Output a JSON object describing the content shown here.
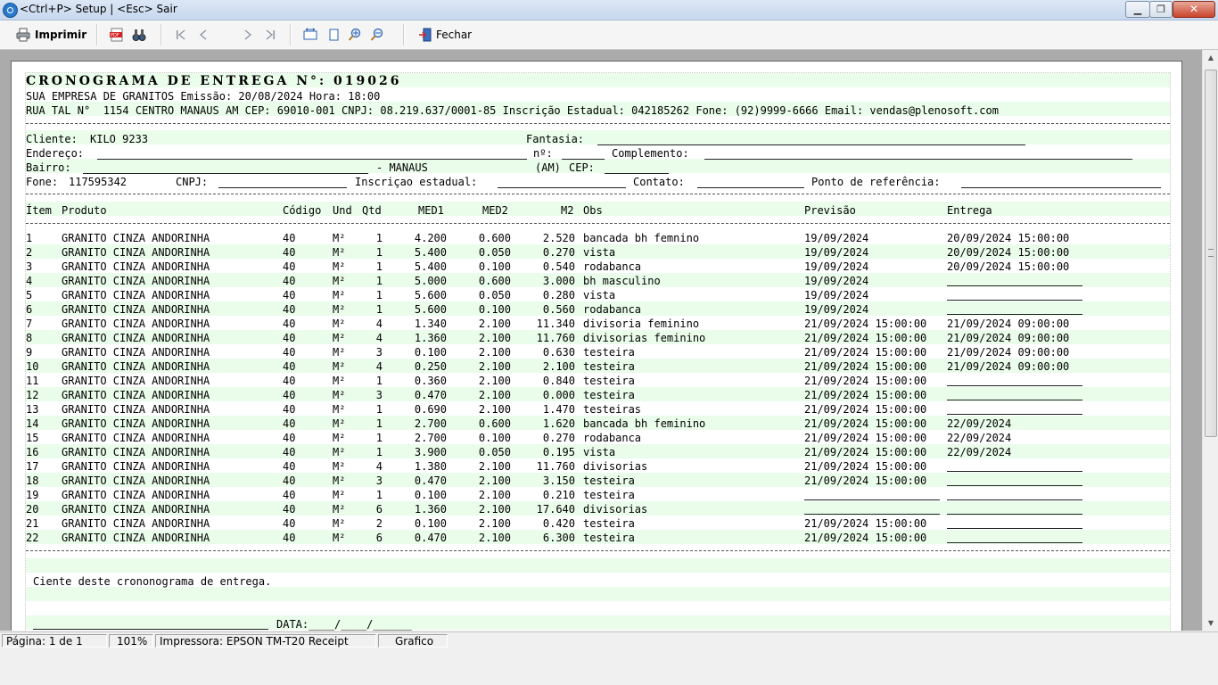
{
  "window": {
    "title": "<Ctrl+P> Setup | <Esc> Sair"
  },
  "toolbar": {
    "print_label": "Imprimir",
    "close_label": "Fechar"
  },
  "report": {
    "title": "CRONOGRAMA DE ENTREGA N°: 019026",
    "company_line": "SUA EMPRESA DE GRANITOS Emissão: 20/08/2024 Hora: 18:00",
    "address_line": "RUA TAL N°  1154 CENTRO MANAUS AM CEP: 69010-001 CNPJ: 08.219.637/0001-85 Inscrição Estadual: 042185262 Fone: (92)9999-6666 Email: vendas@plenosoft.com",
    "client": {
      "cliente_label": "Cliente:",
      "cliente_value": "KILO 9233",
      "fantasia_label": "Fantasia:",
      "endereco_label": "Endereço:",
      "numero_label": "nº:",
      "complemento_label": "Complemento:",
      "bairro_label": "Bairro:",
      "cidade": "- MANAUS",
      "uf": "(AM)",
      "cep_label": "CEP:",
      "fone_label": "Fone:",
      "fone_value": "117595342",
      "cnpj_label": "CNPJ:",
      "ie_label": "Inscriçao estadual:",
      "contato_label": "Contato:",
      "ref_label": "Ponto de referência:"
    },
    "columns": {
      "item": "Ítem",
      "produto": "Produto",
      "codigo": "Código",
      "und": "Und",
      "qtd": "Qtd",
      "med1": "MED1",
      "med2": "MED2",
      "m2": "M2",
      "obs": "Obs",
      "previsao": "Previsão",
      "entrega": "Entrega"
    },
    "items": [
      {
        "item": "1",
        "produto": "GRANITO CINZA ANDORINHA",
        "codigo": "40",
        "und": "M²",
        "qtd": "1",
        "med1": "4.200",
        "med2": "0.600",
        "m2": "2.520",
        "obs": "bancada bh femnino",
        "previsao": "19/09/2024",
        "entrega": "20/09/2024 15:00:00"
      },
      {
        "item": "2",
        "produto": "GRANITO CINZA ANDORINHA",
        "codigo": "40",
        "und": "M²",
        "qtd": "1",
        "med1": "5.400",
        "med2": "0.050",
        "m2": "0.270",
        "obs": "vista",
        "previsao": "19/09/2024",
        "entrega": "20/09/2024 15:00:00"
      },
      {
        "item": "3",
        "produto": "GRANITO CINZA ANDORINHA",
        "codigo": "40",
        "und": "M²",
        "qtd": "1",
        "med1": "5.400",
        "med2": "0.100",
        "m2": "0.540",
        "obs": "rodabanca",
        "previsao": "19/09/2024",
        "entrega": "20/09/2024 15:00:00"
      },
      {
        "item": "4",
        "produto": "GRANITO CINZA ANDORINHA",
        "codigo": "40",
        "und": "M²",
        "qtd": "1",
        "med1": "5.000",
        "med2": "0.600",
        "m2": "3.000",
        "obs": "bh masculino",
        "previsao": "19/09/2024",
        "entrega": ""
      },
      {
        "item": "5",
        "produto": "GRANITO CINZA ANDORINHA",
        "codigo": "40",
        "und": "M²",
        "qtd": "1",
        "med1": "5.600",
        "med2": "0.050",
        "m2": "0.280",
        "obs": "vista",
        "previsao": "19/09/2024",
        "entrega": ""
      },
      {
        "item": "6",
        "produto": "GRANITO CINZA ANDORINHA",
        "codigo": "40",
        "und": "M²",
        "qtd": "1",
        "med1": "5.600",
        "med2": "0.100",
        "m2": "0.560",
        "obs": "rodabanca",
        "previsao": "19/09/2024",
        "entrega": ""
      },
      {
        "item": "7",
        "produto": "GRANITO CINZA ANDORINHA",
        "codigo": "40",
        "und": "M²",
        "qtd": "4",
        "med1": "1.340",
        "med2": "2.100",
        "m2": "11.340",
        "obs": "divisoria feminino",
        "previsao": "21/09/2024 15:00:00",
        "entrega": "21/09/2024 09:00:00"
      },
      {
        "item": "8",
        "produto": "GRANITO CINZA ANDORINHA",
        "codigo": "40",
        "und": "M²",
        "qtd": "4",
        "med1": "1.360",
        "med2": "2.100",
        "m2": "11.760",
        "obs": "divisorias feminino",
        "previsao": "21/09/2024 15:00:00",
        "entrega": "21/09/2024 09:00:00"
      },
      {
        "item": "9",
        "produto": "GRANITO CINZA ANDORINHA",
        "codigo": "40",
        "und": "M²",
        "qtd": "3",
        "med1": "0.100",
        "med2": "2.100",
        "m2": "0.630",
        "obs": "testeira",
        "previsao": "21/09/2024 15:00:00",
        "entrega": "21/09/2024 09:00:00"
      },
      {
        "item": "10",
        "produto": "GRANITO CINZA ANDORINHA",
        "codigo": "40",
        "und": "M²",
        "qtd": "4",
        "med1": "0.250",
        "med2": "2.100",
        "m2": "2.100",
        "obs": "testeira",
        "previsao": "21/09/2024 15:00:00",
        "entrega": "21/09/2024 09:00:00"
      },
      {
        "item": "11",
        "produto": "GRANITO CINZA ANDORINHA",
        "codigo": "40",
        "und": "M²",
        "qtd": "1",
        "med1": "0.360",
        "med2": "2.100",
        "m2": "0.840",
        "obs": "testeira",
        "previsao": "21/09/2024 15:00:00",
        "entrega": ""
      },
      {
        "item": "12",
        "produto": "GRANITO CINZA ANDORINHA",
        "codigo": "40",
        "und": "M²",
        "qtd": "3",
        "med1": "0.470",
        "med2": "2.100",
        "m2": "0.000",
        "obs": "testeira",
        "previsao": "21/09/2024 15:00:00",
        "entrega": ""
      },
      {
        "item": "13",
        "produto": "GRANITO CINZA ANDORINHA",
        "codigo": "40",
        "und": "M²",
        "qtd": "1",
        "med1": "0.690",
        "med2": "2.100",
        "m2": "1.470",
        "obs": "testeiras",
        "previsao": "21/09/2024 15:00:00",
        "entrega": ""
      },
      {
        "item": "14",
        "produto": "GRANITO CINZA ANDORINHA",
        "codigo": "40",
        "und": "M²",
        "qtd": "1",
        "med1": "2.700",
        "med2": "0.600",
        "m2": "1.620",
        "obs": "bancada bh feminino",
        "previsao": "21/09/2024 15:00:00",
        "entrega": "22/09/2024"
      },
      {
        "item": "15",
        "produto": "GRANITO CINZA ANDORINHA",
        "codigo": "40",
        "und": "M²",
        "qtd": "1",
        "med1": "2.700",
        "med2": "0.100",
        "m2": "0.270",
        "obs": "rodabanca",
        "previsao": "21/09/2024 15:00:00",
        "entrega": "22/09/2024"
      },
      {
        "item": "16",
        "produto": "GRANITO CINZA ANDORINHA",
        "codigo": "40",
        "und": "M²",
        "qtd": "1",
        "med1": "3.900",
        "med2": "0.050",
        "m2": "0.195",
        "obs": "vista",
        "previsao": "21/09/2024 15:00:00",
        "entrega": "22/09/2024"
      },
      {
        "item": "17",
        "produto": "GRANITO CINZA ANDORINHA",
        "codigo": "40",
        "und": "M²",
        "qtd": "4",
        "med1": "1.380",
        "med2": "2.100",
        "m2": "11.760",
        "obs": "divisorias",
        "previsao": "21/09/2024 15:00:00",
        "entrega": ""
      },
      {
        "item": "18",
        "produto": "GRANITO CINZA ANDORINHA",
        "codigo": "40",
        "und": "M²",
        "qtd": "3",
        "med1": "0.470",
        "med2": "2.100",
        "m2": "3.150",
        "obs": "testeira",
        "previsao": "21/09/2024 15:00:00",
        "entrega": ""
      },
      {
        "item": "19",
        "produto": "GRANITO CINZA ANDORINHA",
        "codigo": "40",
        "und": "M²",
        "qtd": "1",
        "med1": "0.100",
        "med2": "2.100",
        "m2": "0.210",
        "obs": "testeira",
        "previsao": "",
        "entrega": ""
      },
      {
        "item": "20",
        "produto": "GRANITO CINZA ANDORINHA",
        "codigo": "40",
        "und": "M²",
        "qtd": "6",
        "med1": "1.360",
        "med2": "2.100",
        "m2": "17.640",
        "obs": "divisorias",
        "previsao": "",
        "entrega": ""
      },
      {
        "item": "21",
        "produto": "GRANITO CINZA ANDORINHA",
        "codigo": "40",
        "und": "M²",
        "qtd": "2",
        "med1": "0.100",
        "med2": "2.100",
        "m2": "0.420",
        "obs": "testeira",
        "previsao": "21/09/2024 15:00:00",
        "entrega": ""
      },
      {
        "item": "22",
        "produto": "GRANITO CINZA ANDORINHA",
        "codigo": "40",
        "und": "M²",
        "qtd": "6",
        "med1": "0.470",
        "med2": "2.100",
        "m2": "6.300",
        "obs": "testeira",
        "previsao": "21/09/2024 15:00:00",
        "entrega": ""
      }
    ],
    "footer": {
      "ciente_text": "Ciente deste crononograma de entrega.",
      "data_label": "DATA:____/____/______"
    }
  },
  "statusbar": {
    "page": "Página: 1 de 1",
    "zoom": "101%",
    "printer": "Impressora: EPSON TM-T20 Receipt",
    "mode": "Grafico"
  },
  "icons": {
    "print": "printer-icon",
    "pdf": "pdf-icon",
    "find": "binoculars-icon",
    "first": "first-page-icon",
    "prev": "prev-page-icon",
    "next": "next-page-icon",
    "last": "last-page-icon",
    "fit_width": "page-width-icon",
    "whole_page": "whole-page-icon",
    "zoom_in": "zoom-in-icon",
    "zoom_out": "zoom-out-icon",
    "close": "exit-door-icon"
  },
  "colors": {
    "band": "#eafcea",
    "page": "#ffffff",
    "viewport": "#ababab"
  }
}
